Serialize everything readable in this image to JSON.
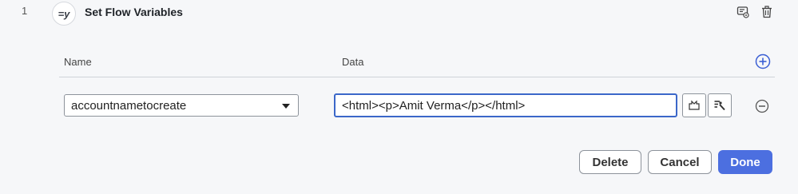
{
  "step": {
    "number": "1",
    "icon_glyph": "=y",
    "icon_name": "flow-variable-icon",
    "title": "Set Flow Variables"
  },
  "top_actions": {
    "icons": [
      "comment-settings-icon",
      "trash-icon"
    ]
  },
  "table": {
    "columns": [
      "Name",
      "Data"
    ],
    "rows": [
      {
        "name": "accountnametocreate",
        "data": "<html><p>Amit Verma</p></html>"
      }
    ],
    "row_action_icons": [
      "expression-icon",
      "resource-picker-icon",
      "remove-row-icon"
    ]
  },
  "buttons": {
    "delete": "Delete",
    "cancel": "Cancel",
    "done": "Done"
  },
  "colors": {
    "accent": "#4c6fe0",
    "focus_border": "#3b67c9",
    "background": "#f6f7f9"
  }
}
